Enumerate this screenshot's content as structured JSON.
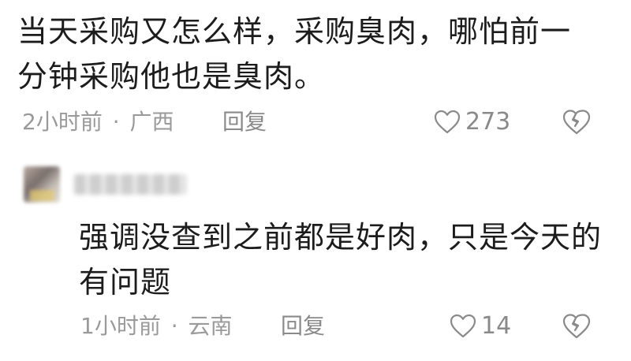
{
  "comments": [
    {
      "text_line1": "当天采购又怎么样，采购臭肉，哪怕前一",
      "text_line2": "分钟采购他也是臭肉。",
      "time": "2小时前",
      "separator": "·",
      "location": "广西",
      "reply_label": "回复",
      "likes": "273"
    },
    {
      "text_line1": "强调没查到之前都是好肉，只是今天的",
      "text_line2": "有问题",
      "time": "1小时前",
      "separator": "·",
      "location": "云南",
      "reply_label": "回复",
      "likes": "14"
    }
  ],
  "icons": {
    "like": "heart-outline-icon",
    "dislike": "broken-heart-icon"
  },
  "colors": {
    "text": "#1c1c1c",
    "meta": "#9a9a9a",
    "icon": "#8a8a8a"
  }
}
